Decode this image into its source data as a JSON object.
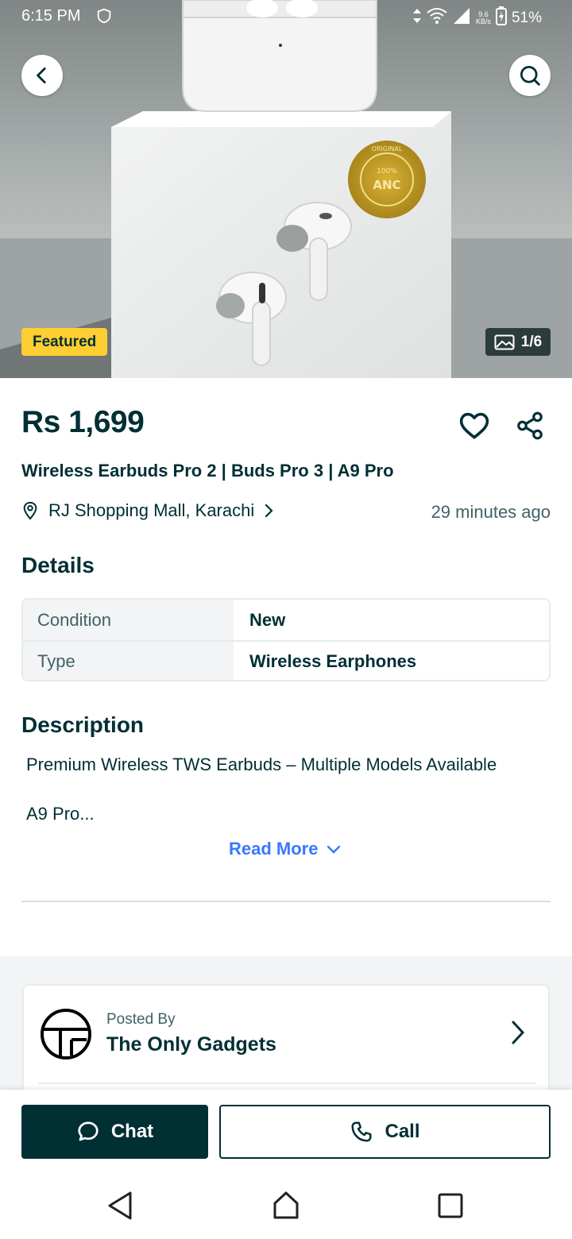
{
  "status_bar": {
    "time": "6:15 PM",
    "net_speed_value": "9.6",
    "net_speed_unit": "KB/s",
    "battery": "51%"
  },
  "hero": {
    "featured_badge": "Featured",
    "image_counter": "1/6",
    "seal_line1": "100%",
    "seal_line2": "ANC",
    "seal_ring": "ORIGINAL"
  },
  "listing": {
    "price": "Rs 1,699",
    "title": "Wireless Earbuds Pro 2 | Buds Pro 3 | A9 Pro",
    "location": "RJ Shopping Mall, Karachi",
    "posted_time": "29 minutes ago"
  },
  "details": {
    "heading": "Details",
    "rows": [
      {
        "key": "Condition",
        "value": "New"
      },
      {
        "key": "Type",
        "value": "Wireless Earphones"
      }
    ]
  },
  "description": {
    "heading": "Description",
    "line1": "Premium Wireless TWS Earbuds – Multiple Models Available",
    "line2": "A9 Pro...",
    "read_more": "Read More"
  },
  "seller": {
    "posted_by_label": "Posted By",
    "name": "The Only Gadgets"
  },
  "actions": {
    "chat": "Chat",
    "call": "Call"
  },
  "colors": {
    "primary": "#002f34",
    "featured": "#ffce32",
    "link": "#3a77ff"
  }
}
